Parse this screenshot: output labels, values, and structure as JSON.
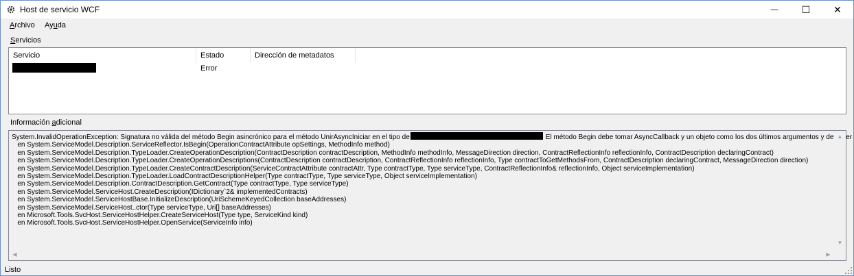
{
  "window": {
    "title": "Host de servicio WCF",
    "controls": {
      "minimize": "—",
      "maximize": "☐",
      "close": "✕"
    }
  },
  "menu": {
    "archivo": {
      "first": "A",
      "rest": "rchivo"
    },
    "ayuda": {
      "first": "Ay",
      "under": "u",
      "rest": "da"
    }
  },
  "services": {
    "label_first": "S",
    "label_rest": "ervicios",
    "columns": [
      "Servicio",
      "Estado",
      "Dirección de metadatos"
    ],
    "rows": [
      {
        "servicio": "",
        "estado": "Error",
        "metadatos": ""
      }
    ]
  },
  "info": {
    "label_pre": "Información ",
    "label_u": "a",
    "label_post": "dicional",
    "line1_pre": "System.InvalidOperationException: Signatura no válida del método Begin asincrónico para el método UnirAsyncIniciar en el tipo de",
    "line1_post": "El método Begin debe tomar AsyncCallback y un objeto como los dos últimos argumentos y devolver IAsyncResult.",
    "stack": [
      "   en System.ServiceModel.Description.ServiceReflector.IsBegin(OperationContractAttribute opSettings, MethodInfo method)",
      "   en System.ServiceModel.Description.TypeLoader.CreateOperationDescription(ContractDescription contractDescription, MethodInfo methodInfo, MessageDirection direction, ContractReflectionInfo reflectionInfo, ContractDescription declaringContract)",
      "   en System.ServiceModel.Description.TypeLoader.CreateOperationDescriptions(ContractDescription contractDescription, ContractReflectionInfo reflectionInfo, Type contractToGetMethodsFrom, ContractDescription declaringContract, MessageDirection direction)",
      "   en System.ServiceModel.Description.TypeLoader.CreateContractDescription(ServiceContractAttribute contractAttr, Type contractType, Type serviceType, ContractReflectionInfo& reflectionInfo, Object serviceImplementation)",
      "   en System.ServiceModel.Description.TypeLoader.LoadContractDescriptionHelper(Type contractType, Type serviceType, Object serviceImplementation)",
      "   en System.ServiceModel.Description.ContractDescription.GetContract(Type contractType, Type serviceType)",
      "   en System.ServiceModel.ServiceHost.CreateDescription(IDictionary`2& implementedContracts)",
      "   en System.ServiceModel.ServiceHostBase.InitializeDescription(UriSchemeKeyedCollection baseAddresses)",
      "   en System.ServiceModel.ServiceHost..ctor(Type serviceType, Uri[] baseAddresses)",
      "   en Microsoft.Tools.SvcHost.ServiceHostHelper.CreateServiceHost(Type type, ServiceKind kind)",
      "   en Microsoft.Tools.SvcHost.ServiceHostHelper.OpenService(ServiceInfo info)"
    ]
  },
  "status": {
    "text": "Listo"
  },
  "icons": {
    "app": "gear-icon"
  }
}
